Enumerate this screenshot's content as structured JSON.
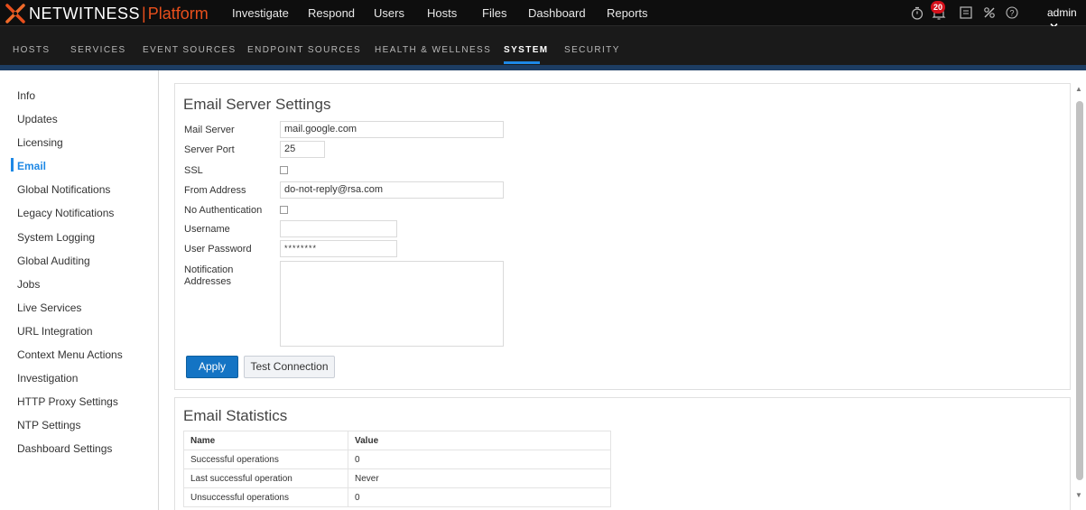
{
  "brand": {
    "name": "NETWITNESS",
    "separator": "|",
    "platform": "Platform",
    "accent": "#e84f1c"
  },
  "main_nav": [
    "Investigate",
    "Respond",
    "Users",
    "Hosts",
    "Files",
    "Dashboard",
    "Reports"
  ],
  "header": {
    "notification_count": "20",
    "user": "admin"
  },
  "sub_nav": {
    "items": [
      "HOSTS",
      "SERVICES",
      "EVENT SOURCES",
      "ENDPOINT SOURCES",
      "HEALTH & WELLNESS",
      "SYSTEM",
      "SECURITY"
    ],
    "active": "SYSTEM"
  },
  "sidebar": {
    "items": [
      "Info",
      "Updates",
      "Licensing",
      "Email",
      "Global Notifications",
      "Legacy Notifications",
      "System Logging",
      "Global Auditing",
      "Jobs",
      "Live Services",
      "URL Integration",
      "Context Menu Actions",
      "Investigation",
      "HTTP Proxy Settings",
      "NTP Settings",
      "Dashboard Settings"
    ],
    "active": "Email"
  },
  "email_settings": {
    "title": "Email Server Settings",
    "mail_server_label": "Mail Server",
    "mail_server_value": "mail.google.com",
    "server_port_label": "Server Port",
    "server_port_value": "25",
    "ssl_label": "SSL",
    "ssl_checked": false,
    "from_address_label": "From Address",
    "from_address_value": "do-not-reply@rsa.com",
    "no_auth_label": "No Authentication",
    "no_auth_checked": false,
    "username_label": "Username",
    "username_value": "",
    "password_label": "User Password",
    "password_value": "********",
    "notification_label_line1": "Notification",
    "notification_label_line2": "Addresses",
    "notification_value": "",
    "apply_label": "Apply",
    "test_label": "Test Connection"
  },
  "email_statistics": {
    "title": "Email Statistics",
    "columns": [
      "Name",
      "Value"
    ],
    "rows": [
      [
        "Successful operations",
        "0"
      ],
      [
        "Last successful operation",
        "Never"
      ],
      [
        "Unsuccessful operations",
        "0"
      ]
    ]
  },
  "icons": [
    "netwitness-logo-icon",
    "timer-icon",
    "notifications-icon",
    "tasks-icon",
    "tools-icon",
    "help-icon",
    "chevron-down-icon"
  ],
  "colors": {
    "accent_blue": "#1e88e5",
    "primary_button": "#1474c4",
    "badge_red": "#d4111b"
  }
}
